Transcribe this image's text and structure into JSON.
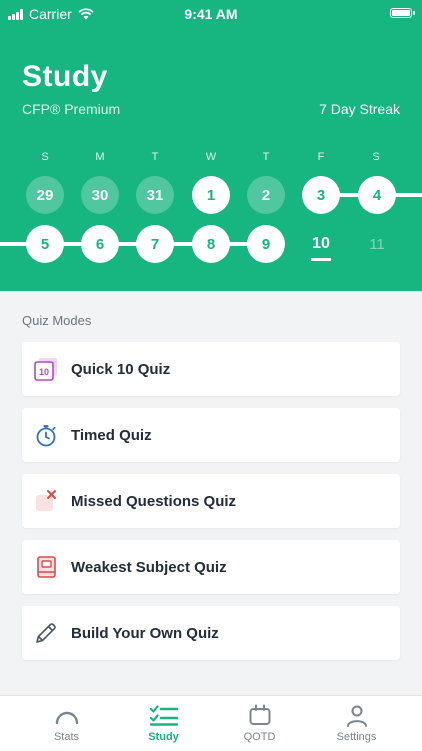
{
  "colors": {
    "brand": "#17b57f",
    "text": "#232d3b",
    "muted": "#7b8591",
    "tab_inactive": "#7b8591"
  },
  "status": {
    "carrier": "Carrier",
    "time": "9:41 AM"
  },
  "header": {
    "title": "Study",
    "subtitle": "CFP® Premium",
    "streak": "7 Day Streak"
  },
  "calendar": {
    "weekdays": [
      "S",
      "M",
      "T",
      "W",
      "T",
      "F",
      "S"
    ],
    "row1": [
      {
        "label": "29",
        "state": "past"
      },
      {
        "label": "30",
        "state": "past"
      },
      {
        "label": "31",
        "state": "past"
      },
      {
        "label": "1",
        "state": "done"
      },
      {
        "label": "2",
        "state": "past"
      },
      {
        "label": "3",
        "state": "done"
      },
      {
        "label": "4",
        "state": "done"
      }
    ],
    "row2": [
      {
        "label": "5",
        "state": "done"
      },
      {
        "label": "6",
        "state": "done"
      },
      {
        "label": "7",
        "state": "done"
      },
      {
        "label": "8",
        "state": "done"
      },
      {
        "label": "9",
        "state": "done"
      },
      {
        "label": "10",
        "state": "today"
      },
      {
        "label": "11",
        "state": "future"
      }
    ]
  },
  "quiz_modes": {
    "label": "Quiz Modes",
    "items": [
      {
        "label": "Quick 10 Quiz",
        "icon": "quick-10-icon"
      },
      {
        "label": "Timed Quiz",
        "icon": "stopwatch-icon"
      },
      {
        "label": "Missed Questions Quiz",
        "icon": "missed-x-icon"
      },
      {
        "label": "Weakest Subject Quiz",
        "icon": "notebook-icon"
      },
      {
        "label": "Build Your Own Quiz",
        "icon": "pencil-icon"
      }
    ],
    "quick10_badge": "10"
  },
  "tabbar": {
    "tabs": [
      {
        "label": "Stats",
        "icon": "gauge-icon"
      },
      {
        "label": "Study",
        "icon": "checklist-icon"
      },
      {
        "label": "QOTD",
        "icon": "calendar-icon"
      },
      {
        "label": "Settings",
        "icon": "person-icon"
      }
    ],
    "active": "Study"
  }
}
